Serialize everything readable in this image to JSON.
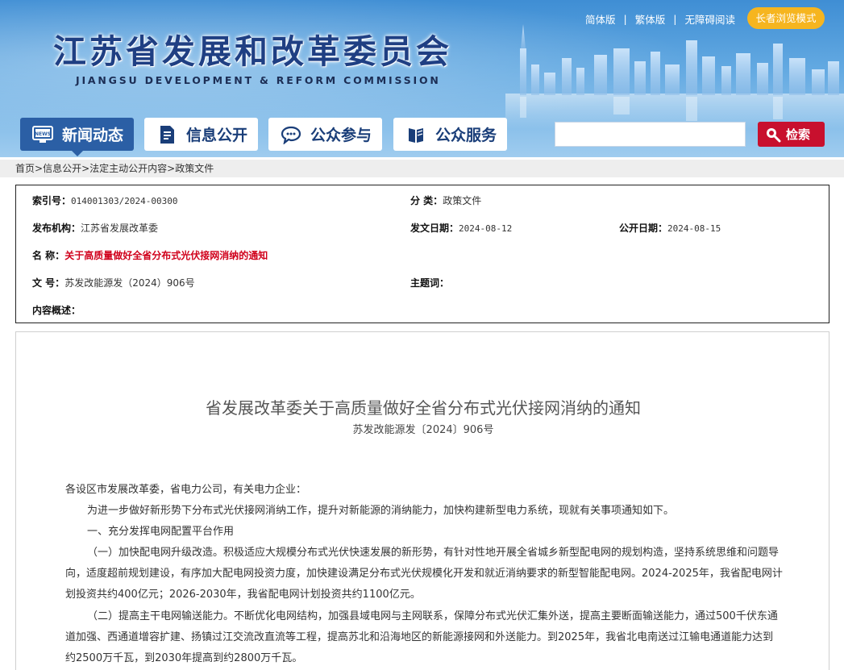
{
  "header": {
    "title": "江苏省发展和改革委员会",
    "subtitle": "JIANGSU DEVELOPMENT & REFORM COMMISSION",
    "links": [
      "简体版",
      "繁体版",
      "无障碍阅读"
    ],
    "separator": "|",
    "elder_mode": "长者浏览模式"
  },
  "nav": {
    "items": [
      {
        "label": "新闻动态",
        "icon": "news-icon"
      },
      {
        "label": "信息公开",
        "icon": "document-icon"
      },
      {
        "label": "公众参与",
        "icon": "chat-bubble-icon"
      },
      {
        "label": "公众服务",
        "icon": "book-icon"
      }
    ],
    "active_index": 0
  },
  "search": {
    "placeholder": "",
    "button_label": "检索"
  },
  "breadcrumb": {
    "items": [
      "首页",
      "信息公开",
      "法定主动公开内容",
      "政策文件"
    ],
    "separator": ">"
  },
  "meta": {
    "index_no": {
      "label": "索引号：",
      "value": "014001303/2024-00300"
    },
    "category": {
      "label": "分 类：",
      "value": "政策文件"
    },
    "publisher": {
      "label": "发布机构：",
      "value": "江苏省发展改革委"
    },
    "issue_date": {
      "label": "发文日期：",
      "value": "2024-08-12"
    },
    "public_date": {
      "label": "公开日期：",
      "value": "2024-08-15"
    },
    "name": {
      "label": "名 称：",
      "value": "关于高质量做好全省分布式光伏接网消纳的通知"
    },
    "doc_no": {
      "label": "文 号：",
      "value": "苏发改能源发（2024）906号"
    },
    "keywords": {
      "label": "主题词：",
      "value": ""
    },
    "summary": {
      "label": "内容概述：",
      "value": ""
    }
  },
  "article": {
    "title": "省发展改革委关于高质量做好全省分布式光伏接网消纳的通知",
    "doc_no": "苏发改能源发〔2024〕906号",
    "paragraphs": [
      "各设区市发展改革委，省电力公司，有关电力企业：",
      "为进一步做好新形势下分布式光伏接网消纳工作，提升对新能源的消纳能力，加快构建新型电力系统，现就有关事项通知如下。",
      "一、充分发挥电网配置平台作用",
      "（一）加快配电网升级改造。积极适应大规模分布式光伏快速发展的新形势，有针对性地开展全省城乡新型配电网的规划构造，坚持系统思维和问题导向，适度超前规划建设，有序加大配电网投资力度，加快建设满足分布式光伏规模化开发和就近消纳要求的新型智能配电网。2024-2025年，我省配电网计划投资共约400亿元；2026-2030年，我省配电网计划投资共约1100亿元。",
      "（二）提高主干电网输送能力。不断优化电网结构，加强县域电网与主网联系，保障分布式光伏汇集外送，提高主要断面输送能力，通过500千伏东通道加强、西通道增容扩建、扬镇过江交流改直流等工程，提高苏北和沿海地区的新能源接网和外送能力。到2025年，我省北电南送过江输电通道能力达到约2500万千瓦，到2030年提高到约2800万千瓦。"
    ]
  },
  "colors": {
    "header_top": "#3f8ed4",
    "nav_active": "#2b5fa5",
    "nav_text": "#1a3e79",
    "search_button": "#c8102e",
    "elder_button": "#f6b51f",
    "doc_name_red": "#d0001b"
  }
}
